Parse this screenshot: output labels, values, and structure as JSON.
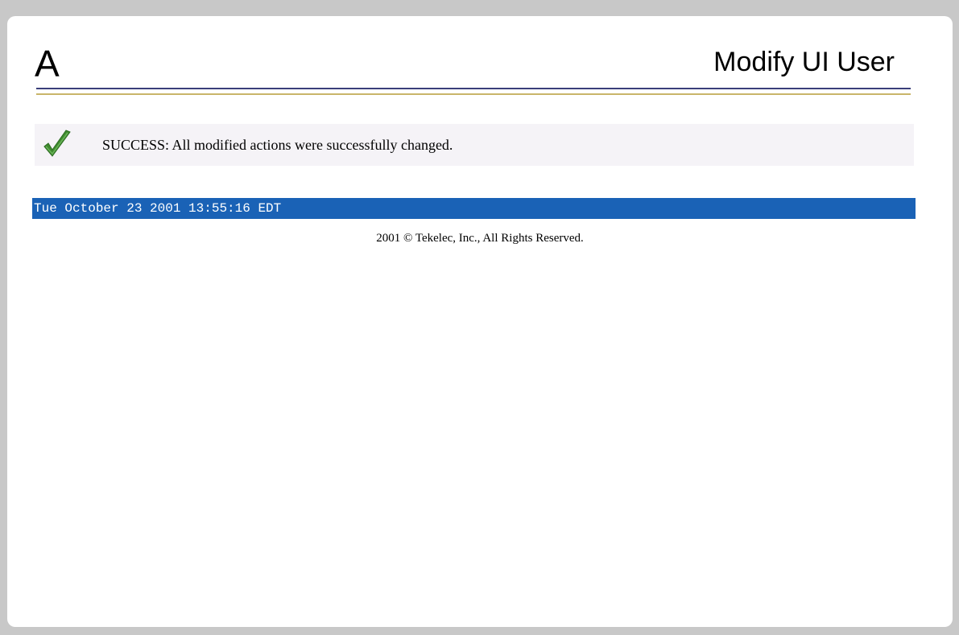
{
  "header": {
    "letter": "A",
    "title": "Modify UI User"
  },
  "message": {
    "icon": "check-icon",
    "text": "SUCCESS: All modified actions were successfully changed."
  },
  "status_bar": {
    "timestamp": "Tue October 23 2001 13:55:16 EDT"
  },
  "footer": {
    "copyright": "2001 © Tekelec, Inc., All Rights Reserved."
  },
  "colors": {
    "status_bar": "#1a62b6",
    "check": "#3f8a2f",
    "rule_top": "#3a3f7a",
    "rule_bottom": "#c9b56a"
  }
}
